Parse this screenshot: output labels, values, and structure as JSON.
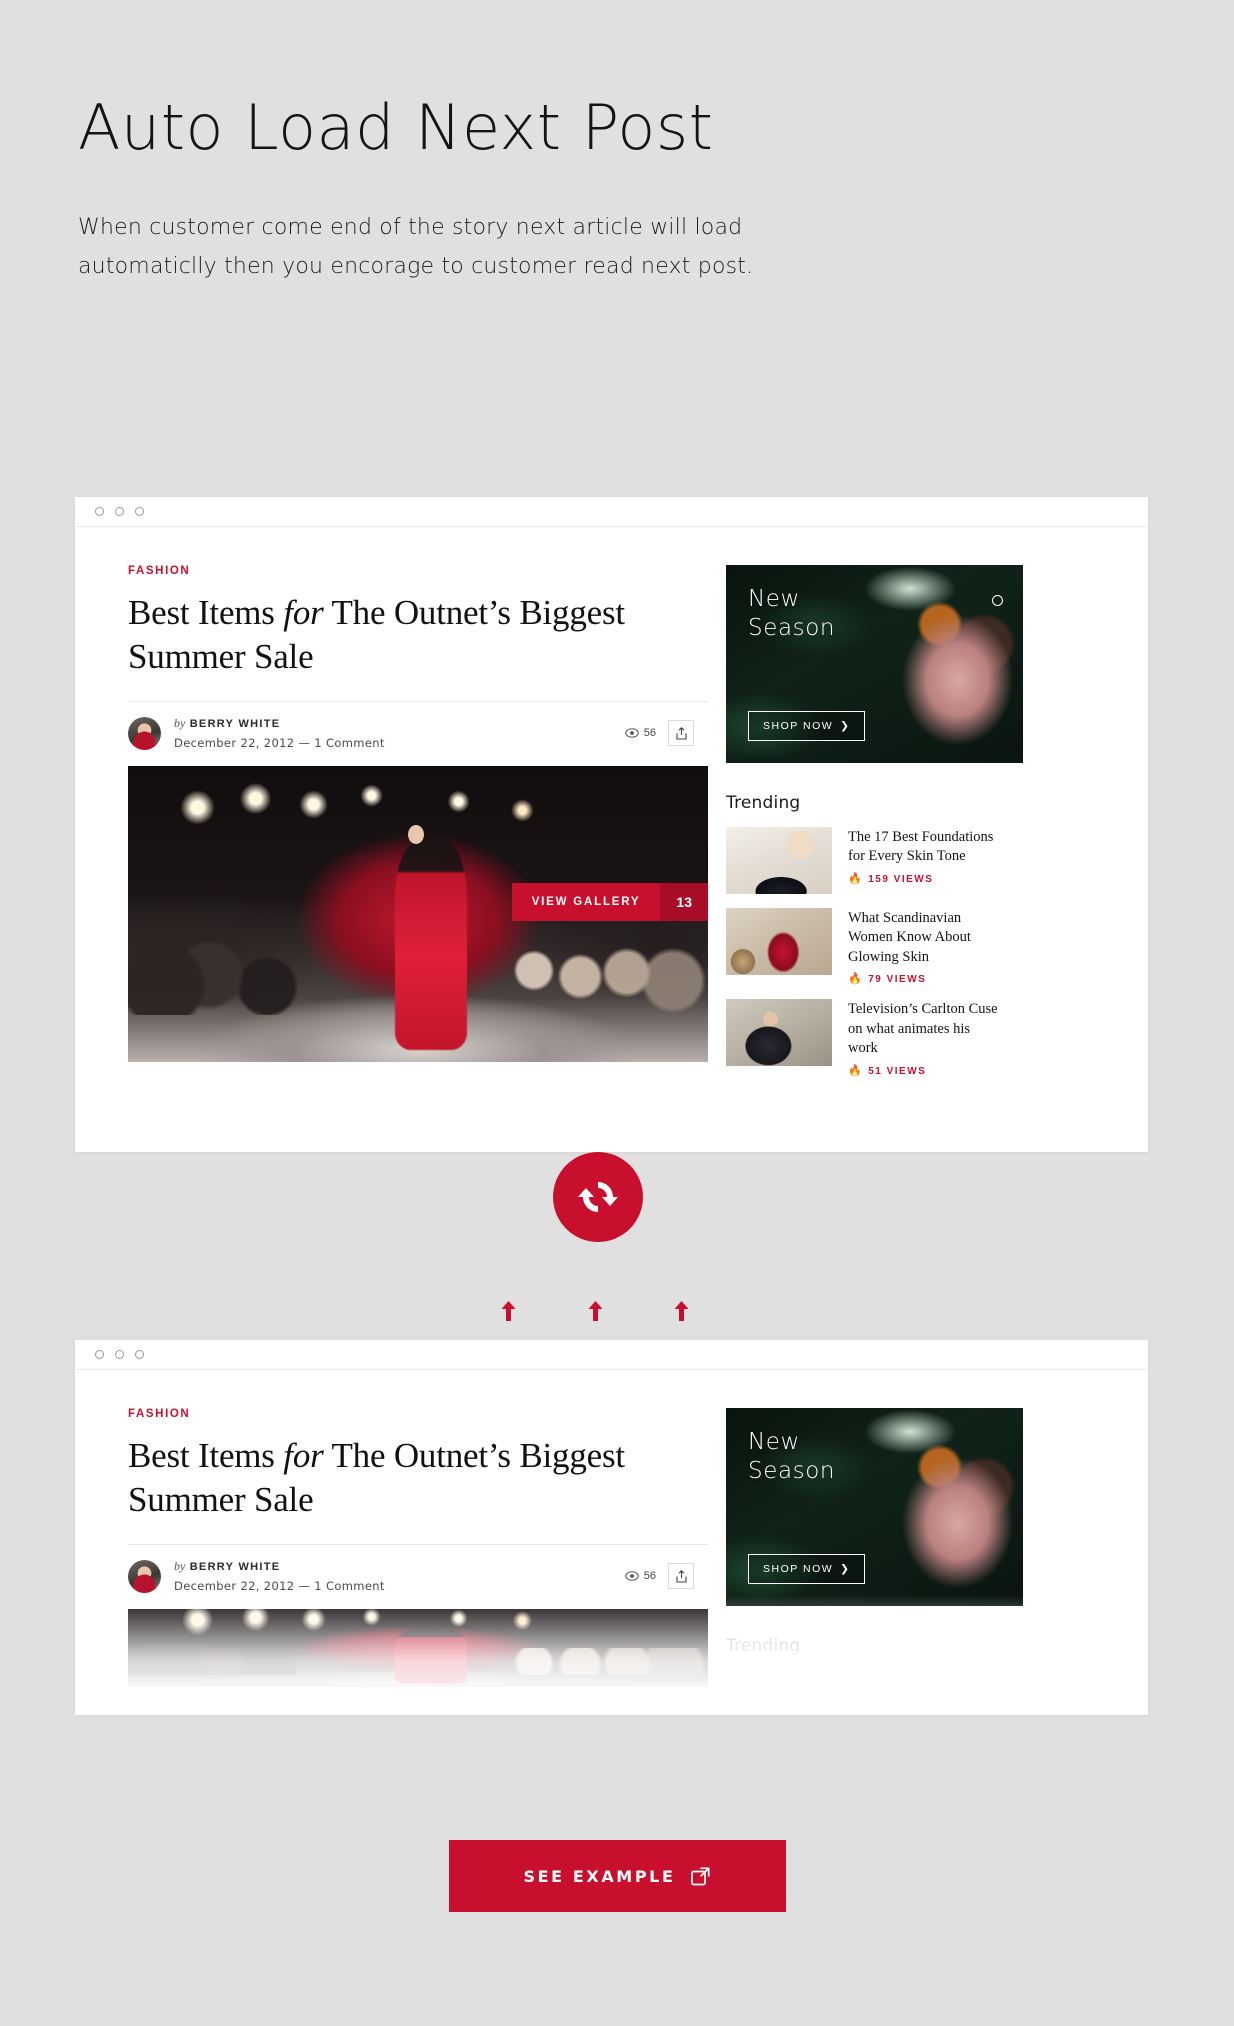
{
  "intro": {
    "title": "Auto Load Next Post",
    "description": "When customer come end of the story next article will load automaticlly then you encorage to customer read next post."
  },
  "colors": {
    "accent": "#c8102e",
    "page_bg": "#e0e0e0",
    "card_bg": "#ffffff",
    "text": "#141414"
  },
  "browser_chrome": {
    "dots": [
      "dot-1",
      "dot-2",
      "dot-3"
    ]
  },
  "article": {
    "kicker": "FASHION",
    "headline_part1": "Best Items ",
    "headline_italic": "for",
    "headline_part2": " The Outnet’s Biggest Summer Sale",
    "author_by": "by",
    "author_name": "BERRY WHITE",
    "date_line": "December 22, 2012  —  1 Comment",
    "view_count": "56",
    "share_icon": "share-icon",
    "eye_icon": "eye-icon",
    "gallery_label": "VIEW GALLERY",
    "gallery_count": "13",
    "gallery_chevron": "❯"
  },
  "sidebar": {
    "ad": {
      "line1": "New",
      "line2": "Season",
      "button_label": "SHOP NOW",
      "button_chevron": "❯",
      "close_icon": "circle-icon"
    },
    "trending_heading": "Trending",
    "trending_items": [
      {
        "title": "The 17 Best Foundations for Every Skin Tone",
        "views": "159 VIEWS",
        "flame_icon": "flame-icon",
        "thumb": "thumb-handbag"
      },
      {
        "title": "What Scandinavian Women Know About Glowing Skin",
        "views": "79 VIEWS",
        "flame_icon": "flame-icon",
        "thumb": "thumb-red-trousers"
      },
      {
        "title": "Television’s Carlton Cuse on what animates his work",
        "views": "51 VIEWS",
        "flame_icon": "flame-icon",
        "thumb": "thumb-seated-man"
      }
    ]
  },
  "overlay": {
    "refresh_icon": "refresh-icon",
    "arrows": [
      "arrow-up-icon",
      "arrow-up-icon",
      "arrow-up-icon"
    ]
  },
  "cta": {
    "label": "SEE EXAMPLE",
    "icon": "external-link-icon"
  }
}
